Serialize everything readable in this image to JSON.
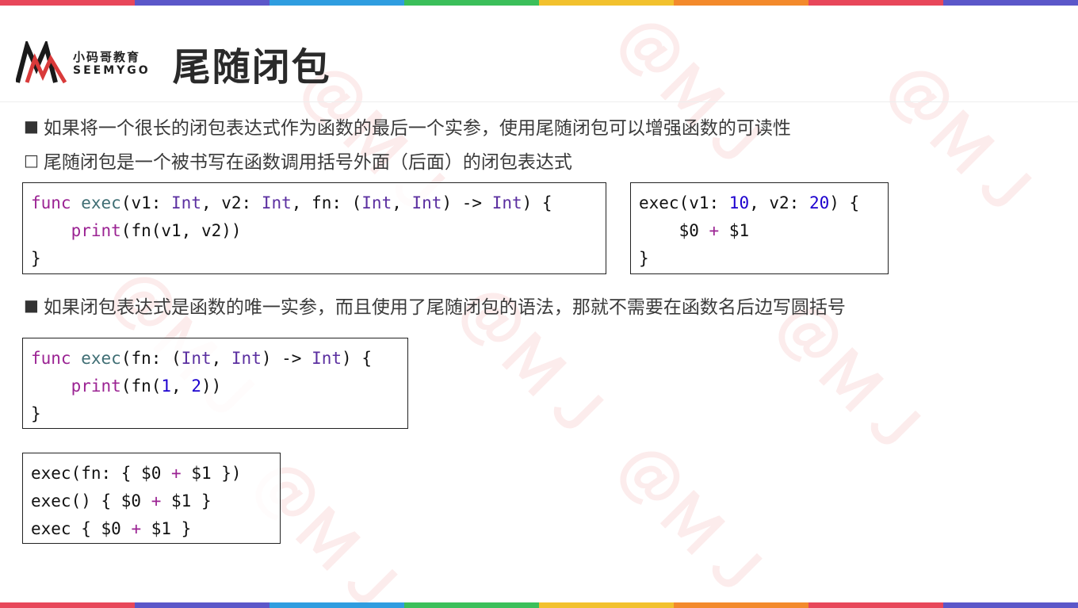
{
  "colors": {
    "stripe": [
      "#e8475a",
      "#5b57c9",
      "#2f9de0",
      "#3bbf5a",
      "#f2c12e",
      "#f38a2c",
      "#e8475a",
      "#5b57c9"
    ],
    "accent": "#d93a3a"
  },
  "logo": {
    "cn": "小码哥教育",
    "en": "SEEMYGO"
  },
  "title": "尾随闭包",
  "bullets": [
    {
      "mark": "■",
      "text": "如果将一个很长的闭包表达式作为函数的最后一个实参，使用尾随闭包可以增强函数的可读性"
    },
    {
      "mark": "□",
      "text": "尾随闭包是一个被书写在函数调用括号外面（后面）的闭包表达式"
    },
    {
      "mark": "■",
      "text": "如果闭包表达式是函数的唯一实参，而且使用了尾随闭包的语法，那就不需要在函数名后边写圆括号"
    }
  ],
  "code1": {
    "l1": {
      "kw": "func",
      "name": "exec",
      "p1": "(v1: ",
      "t1": "Int",
      "p2": ", v2: ",
      "t2": "Int",
      "p3": ", fn: (",
      "t3": "Int",
      "p4": ", ",
      "t4": "Int",
      "p5": ") ",
      "arrow": "->",
      "p6": " ",
      "t5": "Int",
      "p7": ") {"
    },
    "l2": {
      "indent": "    ",
      "call": "print",
      "rest": "(fn(v1, v2))"
    },
    "l3": "}"
  },
  "code2": {
    "l1": {
      "a": "exec(v1: ",
      "n1": "10",
      "b": ", v2: ",
      "n2": "20",
      "c": ") {"
    },
    "l2": {
      "a": "    $0 ",
      "op": "+",
      "b": " $1"
    },
    "l3": "}"
  },
  "code3": {
    "l1": {
      "kw": "func",
      "name": "exec",
      "p1": "(fn: (",
      "t1": "Int",
      "p2": ", ",
      "t2": "Int",
      "p3": ") ",
      "arrow": "->",
      "p4": " ",
      "t3": "Int",
      "p5": ") {"
    },
    "l2": {
      "indent": "    ",
      "call": "print",
      "a": "(fn(",
      "n1": "1",
      "b": ", ",
      "n2": "2",
      "c": "))"
    },
    "l3": "}"
  },
  "code4": {
    "l1": {
      "a": "exec(fn: { $0 ",
      "op": "+",
      "b": " $1 })"
    },
    "l2": {
      "a": "exec() { $0 ",
      "op": "+",
      "b": " $1 }"
    },
    "l3": {
      "a": "exec { $0 ",
      "op": "+",
      "b": " $1 }"
    }
  }
}
